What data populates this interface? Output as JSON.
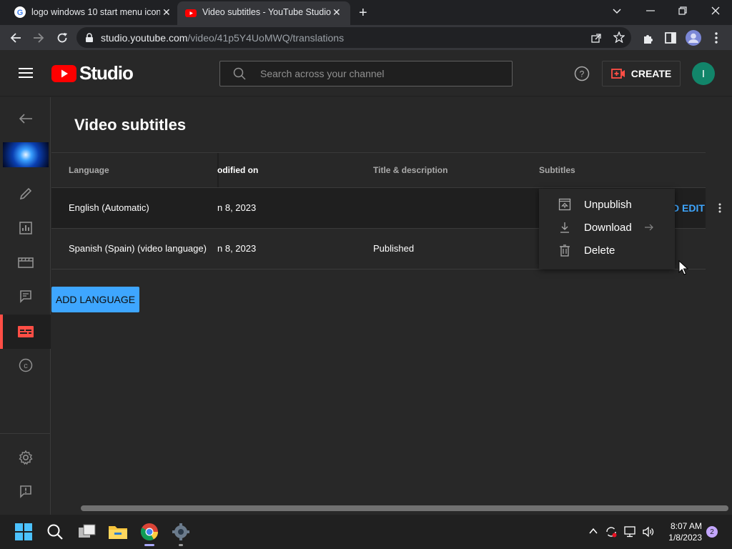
{
  "browser": {
    "tabs": [
      {
        "title": "logo windows 10 start menu icon",
        "active": false
      },
      {
        "title": "Video subtitles - YouTube Studio",
        "active": true
      }
    ],
    "url_host": "studio.youtube.com",
    "url_path": "/video/41p5Y4UoMWQ/translations"
  },
  "header": {
    "logo_text": "Studio",
    "search_placeholder": "Search across your channel",
    "create_label": "CREATE",
    "avatar_letter": "I"
  },
  "page": {
    "title": "Video subtitles",
    "columns": [
      "Language",
      "odified on",
      "Title & description",
      "Subtitles"
    ],
    "rows": [
      {
        "language": "English (Automatic)",
        "modified": "n 8, 2023",
        "title_desc": "",
        "subtitles_action": "D EDIT"
      },
      {
        "language": "Spanish (Spain) (video language)",
        "modified": "n 8, 2023",
        "title_desc": "Published",
        "subtitles_action": ""
      }
    ],
    "add_language_label": "ADD LANGUAGE"
  },
  "context_menu": {
    "items": [
      {
        "label": "Unpublish",
        "icon": "unpublish-icon"
      },
      {
        "label": "Download",
        "icon": "download-icon"
      },
      {
        "label": "Delete",
        "icon": "trash-icon"
      }
    ]
  },
  "taskbar": {
    "time": "8:07 AM",
    "date": "1/8/2023",
    "notification_count": "2"
  },
  "colors": {
    "accent_blue": "#3ea6ff",
    "youtube_red": "#ff0000",
    "active_nav": "#ff4e45"
  }
}
